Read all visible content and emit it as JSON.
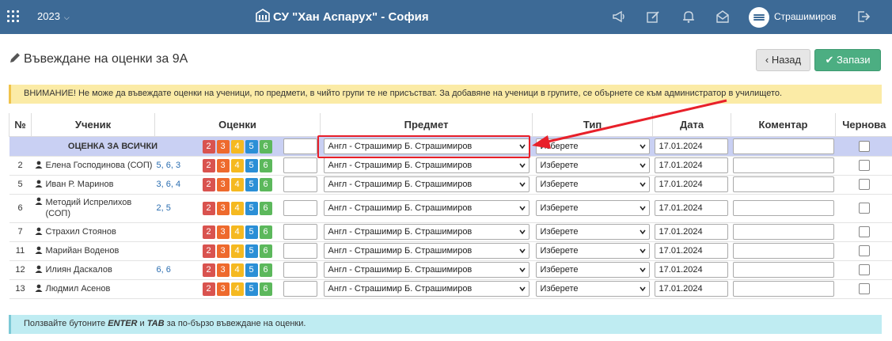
{
  "topbar": {
    "year": "2023",
    "school": "СУ \"Хан Аспарух\" - София",
    "user": "Страшимиров"
  },
  "page": {
    "title": "Въвеждане на оценки за 9А",
    "back_label": "Назад",
    "save_label": "Запази",
    "warning": "ВНИМАНИЕ! Не може да въвеждате оценки на ученици, по предмети, в чийто групи те не присъстват. За добавяне на ученици в групите, се обърнете се към администратор в училището.",
    "info_prefix": "Ползвайте бутоните ",
    "info_enter": "ENTER",
    "info_and": " и ",
    "info_tab": "TAB",
    "info_suffix": " за по-бързо въвеждане на оценки."
  },
  "table": {
    "headers": {
      "num": "№",
      "student": "Ученик",
      "grades": "Оценки",
      "subject": "Предмет",
      "type": "Тип",
      "date": "Дата",
      "comment": "Коментар",
      "draft": "Чернова"
    },
    "grade_buttons": [
      "2",
      "3",
      "4",
      "5",
      "6"
    ],
    "all_row": {
      "label": "ОЦЕНКА ЗА ВСИЧКИ",
      "subject": "Англ - Страшимир Б. Страшимиров",
      "type": "Изберете",
      "date": "17.01.2024"
    },
    "rows": [
      {
        "num": "2",
        "name": "Елена Господинова (СОП)",
        "grades": "5, 6, 3",
        "subject": "Англ - Страшимир Б. Страшимиров",
        "type": "Изберете",
        "date": "17.01.2024"
      },
      {
        "num": "5",
        "name": "Иван Р. Маринов",
        "grades": "3, 6, 4",
        "subject": "Англ - Страшимир Б. Страшимиров",
        "type": "Изберете",
        "date": "17.01.2024"
      },
      {
        "num": "6",
        "name_line1": "Методий Испрелихов",
        "name_line2": "(СОП)",
        "grades": "2, 5",
        "subject": "Англ - Страшимир Б. Страшимиров",
        "type": "Изберете",
        "date": "17.01.2024"
      },
      {
        "num": "7",
        "name": "Страхил Стоянов",
        "grades": "",
        "subject": "Англ - Страшимир Б. Страшимиров",
        "type": "Изберете",
        "date": "17.01.2024"
      },
      {
        "num": "11",
        "name": "Марийан Воденов",
        "grades": "",
        "subject": "Англ - Страшимир Б. Страшимиров",
        "type": "Изберете",
        "date": "17.01.2024"
      },
      {
        "num": "12",
        "name": "Илиян Даскалов",
        "grades": "6, 6",
        "subject": "Англ - Страшимир Б. Страшимиров",
        "type": "Изберете",
        "date": "17.01.2024"
      },
      {
        "num": "13",
        "name": "Людмил Асенов",
        "grades": "",
        "subject": "Англ - Страшимир Б. Страшимиров",
        "type": "Изберете",
        "date": "17.01.2024"
      }
    ]
  },
  "colors": {
    "topbar": "#3d6a96",
    "grade_2": "#d9534f",
    "grade_3": "#ee6a2d",
    "grade_4": "#f5b920",
    "grade_5": "#2b8fd6",
    "grade_6": "#5cb85c",
    "save_button": "#4cae82",
    "highlight": "#e8202a"
  }
}
